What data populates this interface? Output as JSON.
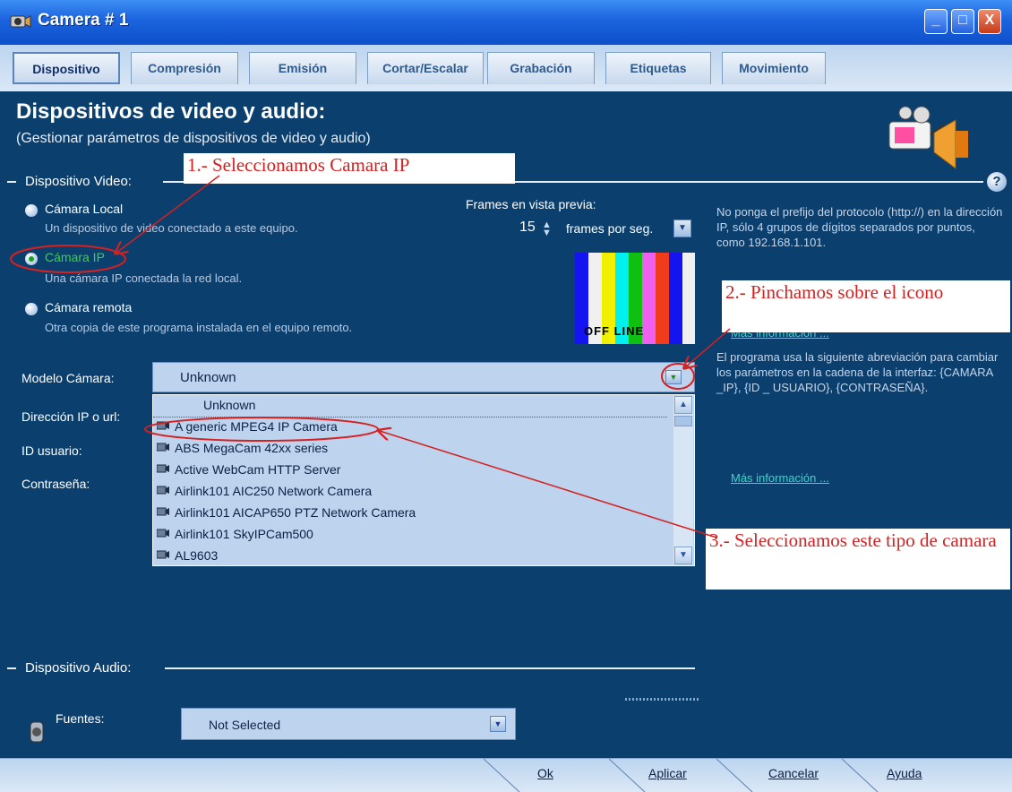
{
  "window": {
    "title": "Camera # 1",
    "controls": {
      "minimize": "_",
      "maximize": "□",
      "close": "X"
    }
  },
  "tabs": [
    "Dispositivo",
    "Compresión",
    "Emisión",
    "Cortar/Escalar",
    "Grabación",
    "Etiquetas",
    "Movimiento"
  ],
  "header": {
    "title": "Dispositivos de video y audio:",
    "subtitle": "(Gestionar parámetros de dispositivos de video y audio)"
  },
  "video_section": {
    "label": "Dispositivo Video:"
  },
  "options": {
    "local": {
      "label": "Cámara Local",
      "desc": "Un dispositivo de video conectado a este equipo."
    },
    "ip": {
      "label": "Cámara IP",
      "desc": "Una cámara IP conectada la red local."
    },
    "remote": {
      "label": "Cámara remota",
      "desc": "Otra copia de este programa instalada en el equipo remoto."
    }
  },
  "preview": {
    "label": "Frames en vista previa:",
    "fps": "15",
    "unit": "frames por seg.",
    "offline": "OFF LINE"
  },
  "info": {
    "text1": "No ponga el prefijo del protocolo (http://) en la dirección IP, sólo 4 grupos de dígitos separados por puntos, como 192.168.1.101.",
    "link1": "Más información ...",
    "text2": "El programa usa la siguiente abreviación para cambiar los parámetros en la cadena de la interfaz: {CAMARA _IP}, {ID _ USUARIO}, {CONTRASEÑA}.",
    "link2": "Más información ..."
  },
  "fields": {
    "model": "Modelo Cámara:",
    "ip": "Dirección IP o url:",
    "user": "ID usuario:",
    "password": "Contraseña:"
  },
  "model_combo": {
    "value": "Unknown"
  },
  "model_list": [
    "Unknown",
    "A generic MPEG4 IP Camera",
    "ABS MegaCam 42xx series",
    "Active WebCam HTTP Server",
    "Airlink101 AIC250 Network Camera",
    "Airlink101 AICAP650 PTZ Network Camera",
    "Airlink101 SkyIPCam500",
    "AL9603"
  ],
  "audio_section": {
    "label": "Dispositivo Audio:",
    "sources_label": "Fuentes:",
    "sources_value": "Not Selected"
  },
  "buttons": {
    "ok": "Ok",
    "apply": "Aplicar",
    "cancel": "Cancelar",
    "help": "Ayuda"
  },
  "annotations": {
    "a1": "1.- Seleccionamos Camara IP",
    "a2": "2.- Pinchamos sobre el icono",
    "a3": "3.- Seleccionamos este tipo de camara"
  },
  "colors": {
    "panel_bg": "#0b3f6e",
    "title_bar": "#1b63de",
    "annotation_red": "#d62020",
    "selected_green": "#3bd23b"
  }
}
